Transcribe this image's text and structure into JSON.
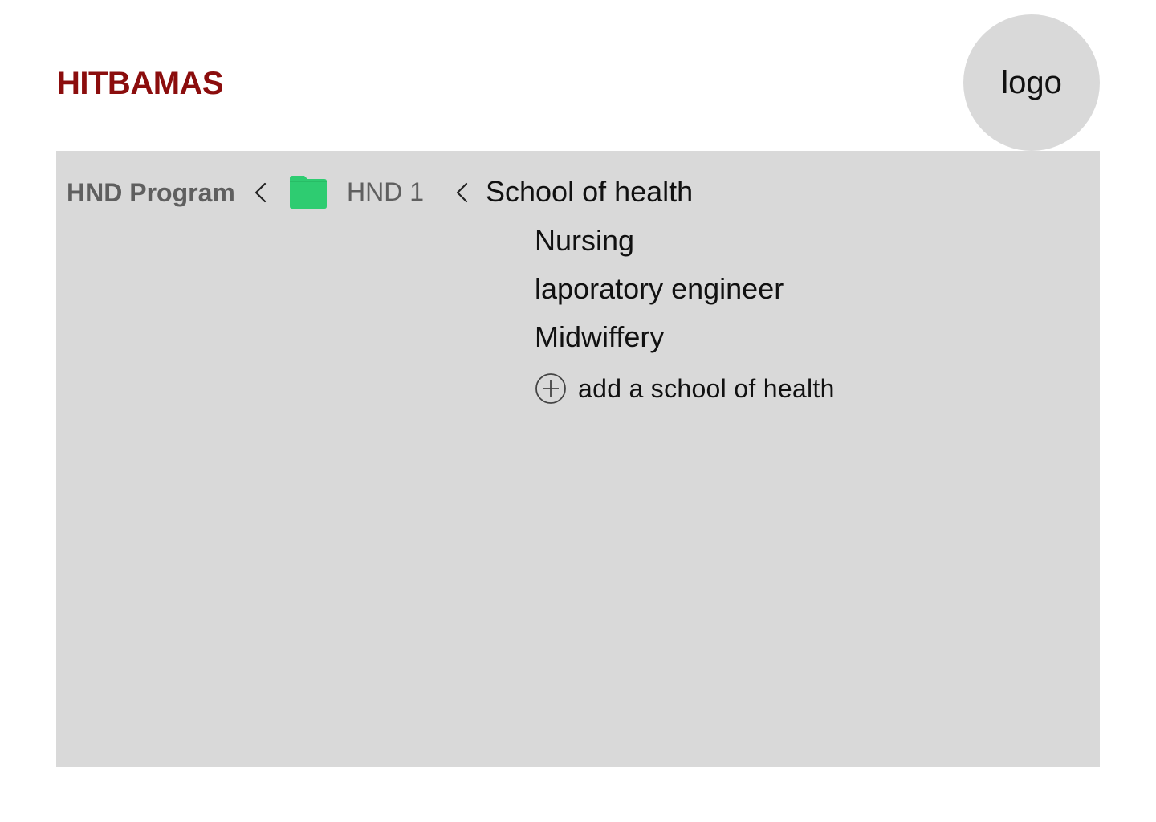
{
  "header": {
    "brand": "HITBAMAS",
    "logo_label": "logo"
  },
  "breadcrumb": {
    "program": "HND Program",
    "level": "HND 1",
    "current": "School of health",
    "separator_icon": "chevron-left-icon",
    "folder_icon": "folder-icon",
    "folder_color": "#2ecc71"
  },
  "schools": {
    "items": [
      {
        "label": "Nursing"
      },
      {
        "label": "laporatory engineer"
      },
      {
        "label": "Midwiffery"
      }
    ],
    "add_label": "add a school of health",
    "add_icon": "plus-circle-icon"
  },
  "colors": {
    "brand": "#8b0d0d",
    "panel": "#d9d9d9",
    "muted_text": "#5f5f5f"
  }
}
